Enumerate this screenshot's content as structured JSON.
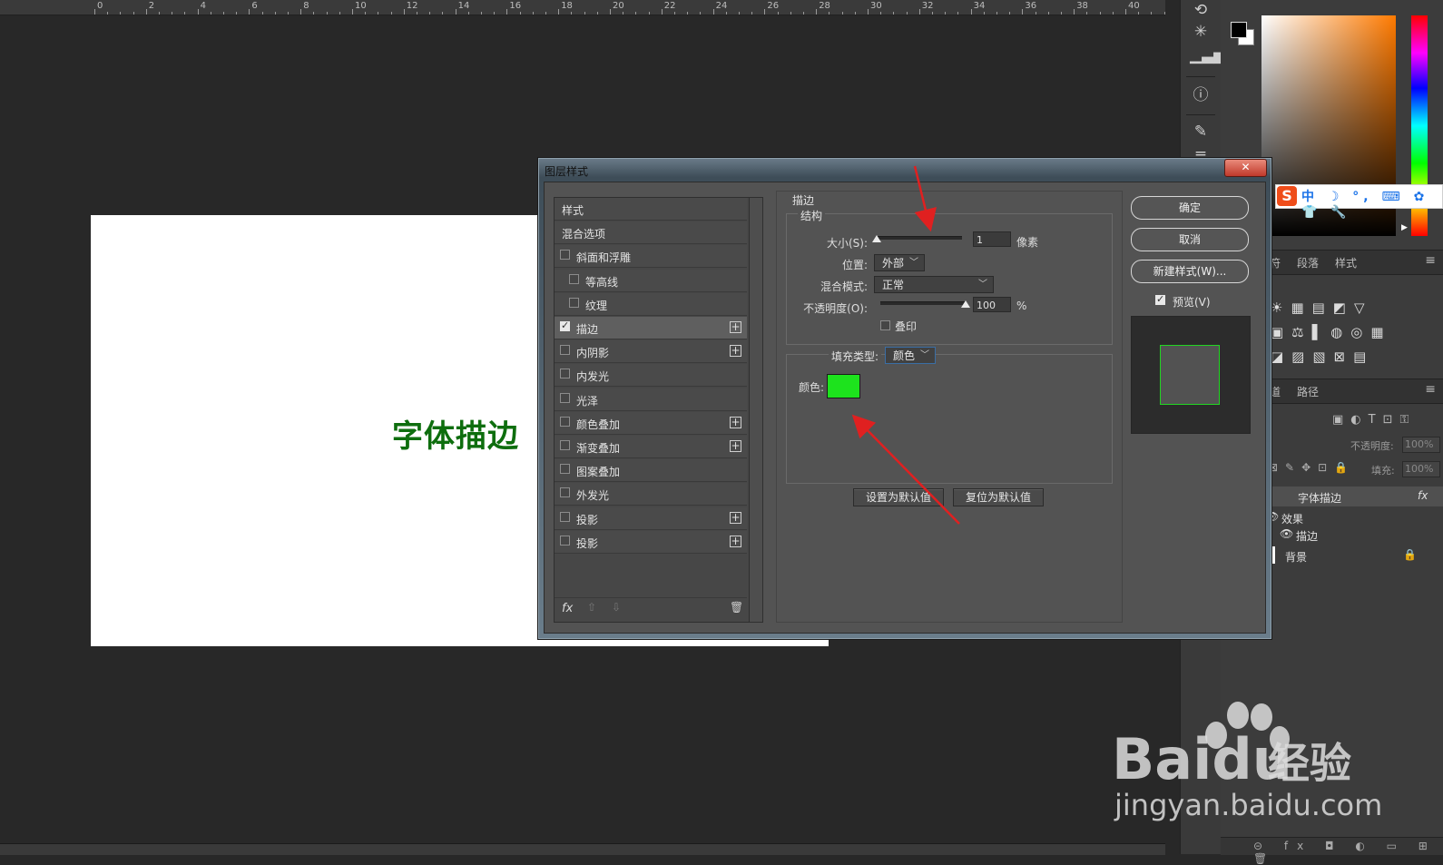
{
  "ruler": {
    "labels": [
      "0",
      "2",
      "4",
      "6",
      "8",
      "10",
      "12",
      "14",
      "16",
      "18",
      "20",
      "22",
      "24",
      "26",
      "28",
      "30",
      "32",
      "34",
      "36",
      "38",
      "40"
    ]
  },
  "canvas": {
    "text": "字体描边",
    "text_color": "#0e6e0e"
  },
  "dialog": {
    "title": "图层样式",
    "close_label": "✕",
    "styles_list": [
      {
        "label": "样式",
        "checkbox": false,
        "checked": false,
        "plus": false,
        "indent": 0
      },
      {
        "label": "混合选项",
        "checkbox": false,
        "checked": false,
        "plus": false,
        "indent": 0
      },
      {
        "label": "斜面和浮雕",
        "checkbox": true,
        "checked": false,
        "plus": false,
        "indent": 0
      },
      {
        "label": "等高线",
        "checkbox": true,
        "checked": false,
        "plus": false,
        "indent": 1
      },
      {
        "label": "纹理",
        "checkbox": true,
        "checked": false,
        "plus": false,
        "indent": 1
      },
      {
        "label": "描边",
        "checkbox": true,
        "checked": true,
        "plus": true,
        "indent": 0,
        "selected": true
      },
      {
        "label": "内阴影",
        "checkbox": true,
        "checked": false,
        "plus": true,
        "indent": 0
      },
      {
        "label": "内发光",
        "checkbox": true,
        "checked": false,
        "plus": false,
        "indent": 0
      },
      {
        "label": "光泽",
        "checkbox": true,
        "checked": false,
        "plus": false,
        "indent": 0
      },
      {
        "label": "颜色叠加",
        "checkbox": true,
        "checked": false,
        "plus": true,
        "indent": 0
      },
      {
        "label": "渐变叠加",
        "checkbox": true,
        "checked": false,
        "plus": true,
        "indent": 0
      },
      {
        "label": "图案叠加",
        "checkbox": true,
        "checked": false,
        "plus": false,
        "indent": 0
      },
      {
        "label": "外发光",
        "checkbox": true,
        "checked": false,
        "plus": false,
        "indent": 0
      },
      {
        "label": "投影",
        "checkbox": true,
        "checked": false,
        "plus": true,
        "indent": 0
      },
      {
        "label": "投影",
        "checkbox": true,
        "checked": false,
        "plus": true,
        "indent": 0
      }
    ],
    "footer": {
      "fx_label": "fx",
      "up_icon": "arrow-up-icon",
      "down_icon": "arrow-down-icon",
      "trash_icon": "trash-icon"
    },
    "stroke": {
      "section_title": "描边",
      "structure_title": "结构",
      "size_label": "大小(S):",
      "size_value": "1",
      "size_unit": "像素",
      "size_fraction": 0.0,
      "position_label": "位置:",
      "position_value": "外部",
      "blend_label": "混合模式:",
      "blend_value": "正常",
      "opacity_label": "不透明度(O):",
      "opacity_value": "100",
      "opacity_unit": "%",
      "opacity_fraction": 1.0,
      "overprint_label": "叠印",
      "overprint_checked": false,
      "fill_type_label": "填充类型:",
      "fill_type_value": "颜色",
      "color_label": "颜色:",
      "color_hex": "#1de31d",
      "set_default_label": "设置为默认值",
      "reset_default_label": "复位为默认值"
    },
    "buttons": {
      "ok": "确定",
      "cancel": "取消",
      "new_style": "新建样式(W)...",
      "preview_label": "预览(V)",
      "preview_checked": true
    }
  },
  "panels": {
    "ime_text": "中 ☽ °, ⌨ ✿ 👕 🔧",
    "tabs_a": [
      "字符",
      "段落",
      "样式"
    ],
    "tabs_b": [
      "通道",
      "路径"
    ],
    "adj_rows": [
      "☀▦▤◩▽",
      "▣⚖▌◍◎▦",
      "◪▨▧⊠▤"
    ],
    "opacity_label": "不透明度:",
    "opacity_value": "100%",
    "fill_label": "填充:",
    "fill_value": "100%",
    "layers": {
      "text_layer": "字体描边",
      "effects": "效果",
      "stroke_effect": "描边",
      "background": "背景",
      "fx_badge": "fx"
    }
  },
  "watermark": {
    "bai": "Bai",
    "du": "du",
    "jingyan": "经验",
    "url": "jingyan.baidu.com"
  }
}
